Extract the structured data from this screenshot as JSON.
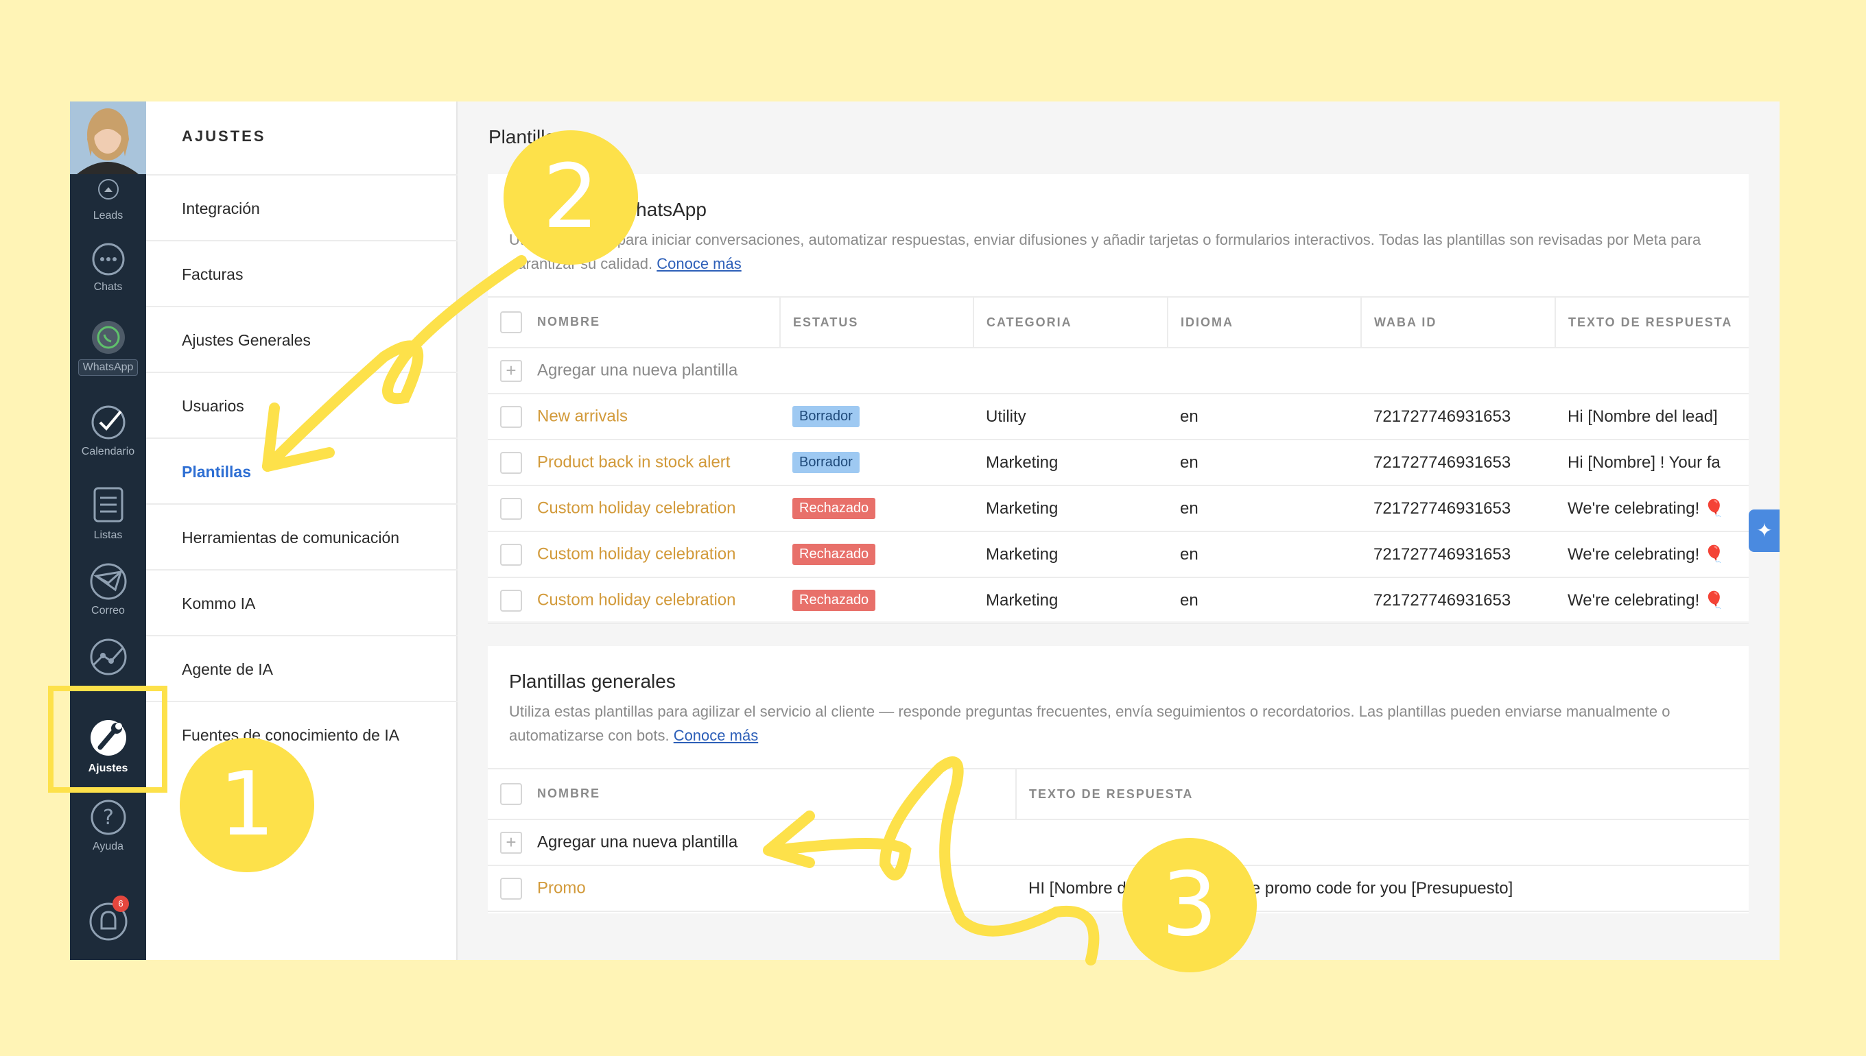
{
  "nav": {
    "items": [
      {
        "label": "Leads",
        "icon": "leads-icon"
      },
      {
        "label": "Chats",
        "icon": "chats-icon"
      },
      {
        "label": "WhatsApp",
        "icon": "whatsapp-icon"
      },
      {
        "label": "Calendario",
        "icon": "calendar-check-icon"
      },
      {
        "label": "Listas",
        "icon": "list-icon"
      },
      {
        "label": "Correo",
        "icon": "mail-icon"
      },
      {
        "label": "Ajustes",
        "icon": "settings-wrench-icon"
      },
      {
        "label": "Ayuda",
        "icon": "help-icon"
      }
    ],
    "notifications_count": "6"
  },
  "settings": {
    "title": "AJUSTES",
    "items": [
      {
        "label": "Integración"
      },
      {
        "label": "Facturas"
      },
      {
        "label": "Ajustes Generales"
      },
      {
        "label": "Usuarios"
      },
      {
        "label": "Plantillas"
      },
      {
        "label": "Herramientas de comunicación"
      },
      {
        "label": "Kommo IA"
      },
      {
        "label": "Agente de IA"
      },
      {
        "label": "Fuentes de conocimiento de IA"
      }
    ],
    "active": "Plantillas"
  },
  "main": {
    "page_title": "Plantillas",
    "whatsapp": {
      "title": "Plantillas de WhatsApp",
      "desc": "Utiliza plantillas para iniciar conversaciones, automatizar respuestas, enviar difusiones y añadir tarjetas o formularios interactivos. Todas las plantillas son revisadas por Meta para garantizar su calidad. ",
      "link": "Conoce más",
      "headers": [
        "NOMBRE",
        "ESTATUS",
        "CATEGORIA",
        "IDIOMA",
        "WABA ID",
        "TEXTO DE RESPUESTA"
      ],
      "add_label": "Agregar una nueva plantilla",
      "rows": [
        {
          "name": "New arrivals",
          "status": "Borrador",
          "status_type": "draft",
          "category": "Utility",
          "lang": "en",
          "waba": "721727746931653",
          "text": "Hi [Nombre del lead]"
        },
        {
          "name": "Product back in stock alert",
          "status": "Borrador",
          "status_type": "draft",
          "category": "Marketing",
          "lang": "en",
          "waba": "721727746931653",
          "text": "Hi [Nombre] ! Your fa"
        },
        {
          "name": "Custom holiday celebration",
          "status": "Rechazado",
          "status_type": "rej",
          "category": "Marketing",
          "lang": "en",
          "waba": "721727746931653",
          "text": "We're celebrating! 🎈"
        },
        {
          "name": "Custom holiday celebration",
          "status": "Rechazado",
          "status_type": "rej",
          "category": "Marketing",
          "lang": "en",
          "waba": "721727746931653",
          "text": "We're celebrating! 🎈"
        },
        {
          "name": "Custom holiday celebration",
          "status": "Rechazado",
          "status_type": "rej",
          "category": "Marketing",
          "lang": "en",
          "waba": "721727746931653",
          "text": "We're celebrating! 🎈"
        }
      ]
    },
    "general": {
      "title": "Plantillas generales",
      "desc": "Utiliza estas plantillas para agilizar el servicio al cliente — responde preguntas frecuentes, envía seguimientos o recordatorios. Las plantillas pueden enviarse manualmente o automatizarse con bots. ",
      "link": "Conoce más",
      "headers": [
        "NOMBRE",
        "TEXTO DE RESPUESTA"
      ],
      "add_label": "Agregar una nueva plantilla",
      "rows": [
        {
          "name": "Promo",
          "text": "HI [Nombre del lead], here's the promo code for you [Presupuesto]"
        }
      ]
    }
  },
  "annotations": {
    "step1": "1",
    "step2": "2",
    "step3": "3",
    "color": "#fde14a"
  }
}
